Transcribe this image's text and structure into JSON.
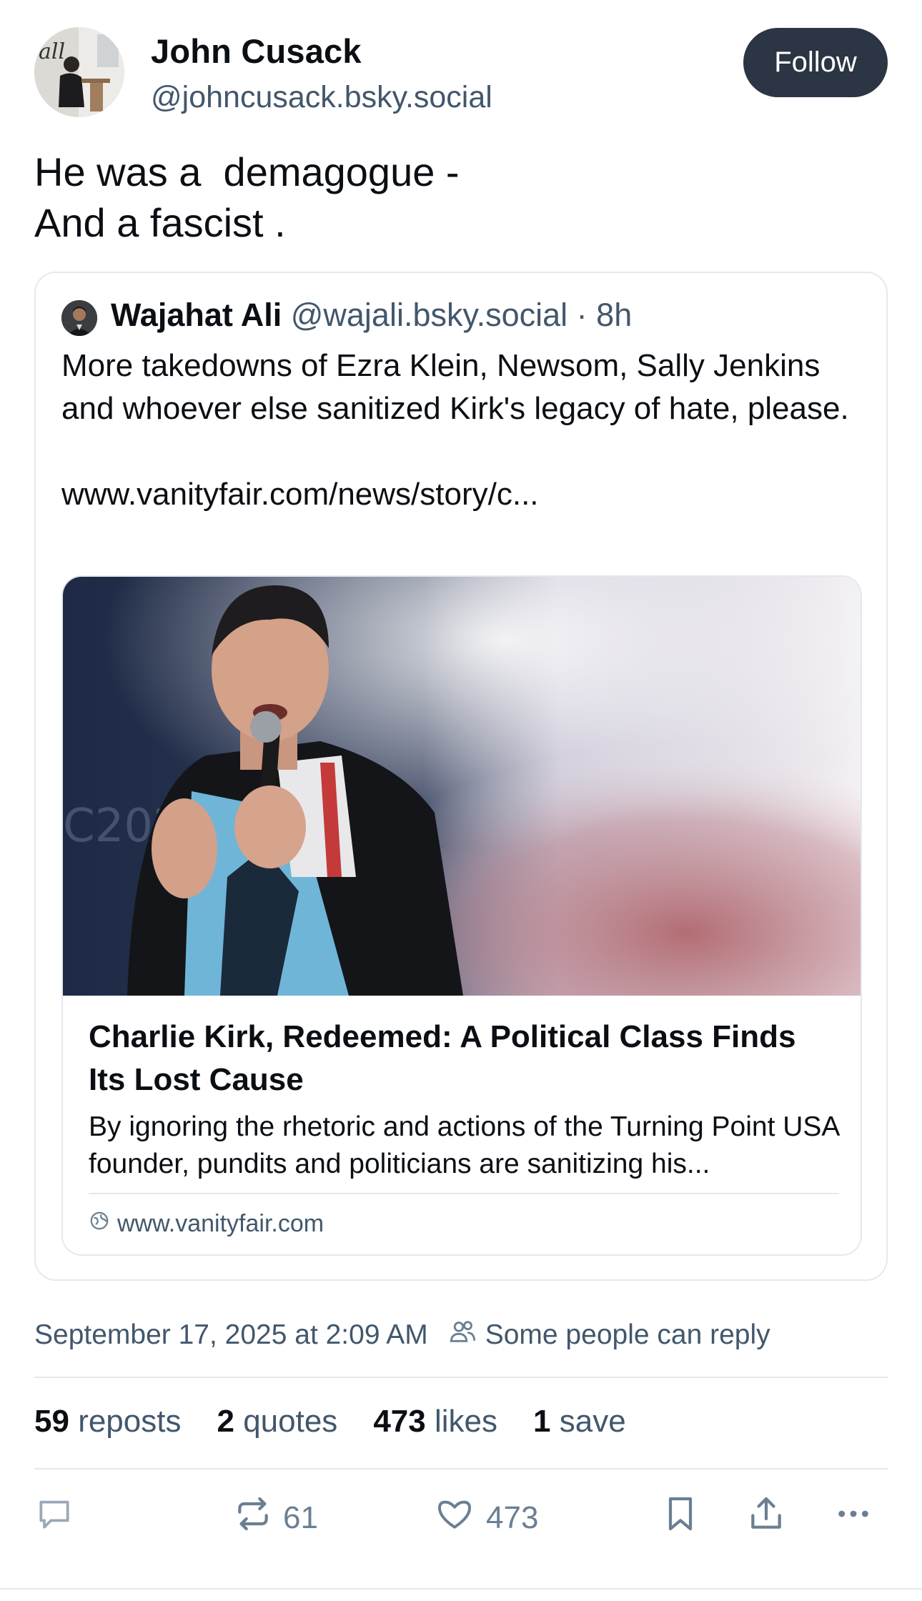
{
  "author": {
    "name": "John Cusack",
    "handle": "@johncusack.bsky.social",
    "follow_label": "Follow"
  },
  "post": {
    "text": "He was a  demagogue -\nAnd a fascist ."
  },
  "quote": {
    "name": "Wajahat Ali",
    "handle": "@wajali.bsky.social · 8h",
    "text": "More takedowns of Ezra Klein, Newsom, Sally Jenkins and whoever else sanitized Kirk's legacy of hate, please.\n\nwww.vanityfair.com/news/story/c...",
    "link": {
      "title": "Charlie Kirk, Redeemed: A Political Class Finds Its Lost Cause",
      "description": "By ignoring the rhetoric and actions of the Turning Point USA founder, pundits and politicians are sanitizing his...",
      "domain": "www.vanityfair.com"
    }
  },
  "meta": {
    "timestamp": "September 17, 2025 at 2:09 AM",
    "reply_setting": "Some people can reply"
  },
  "stats": {
    "reposts_count": "59",
    "reposts_label": "reposts",
    "quotes_count": "2",
    "quotes_label": "quotes",
    "likes_count": "473",
    "likes_label": "likes",
    "saves_count": "1",
    "saves_label": "save"
  },
  "actions": {
    "repost_count": "61",
    "like_count": "473"
  },
  "colors": {
    "follow_bg": "#2b3543",
    "muted": "#42576c",
    "icon": "#6b7f93",
    "border": "#e4e8ee"
  }
}
